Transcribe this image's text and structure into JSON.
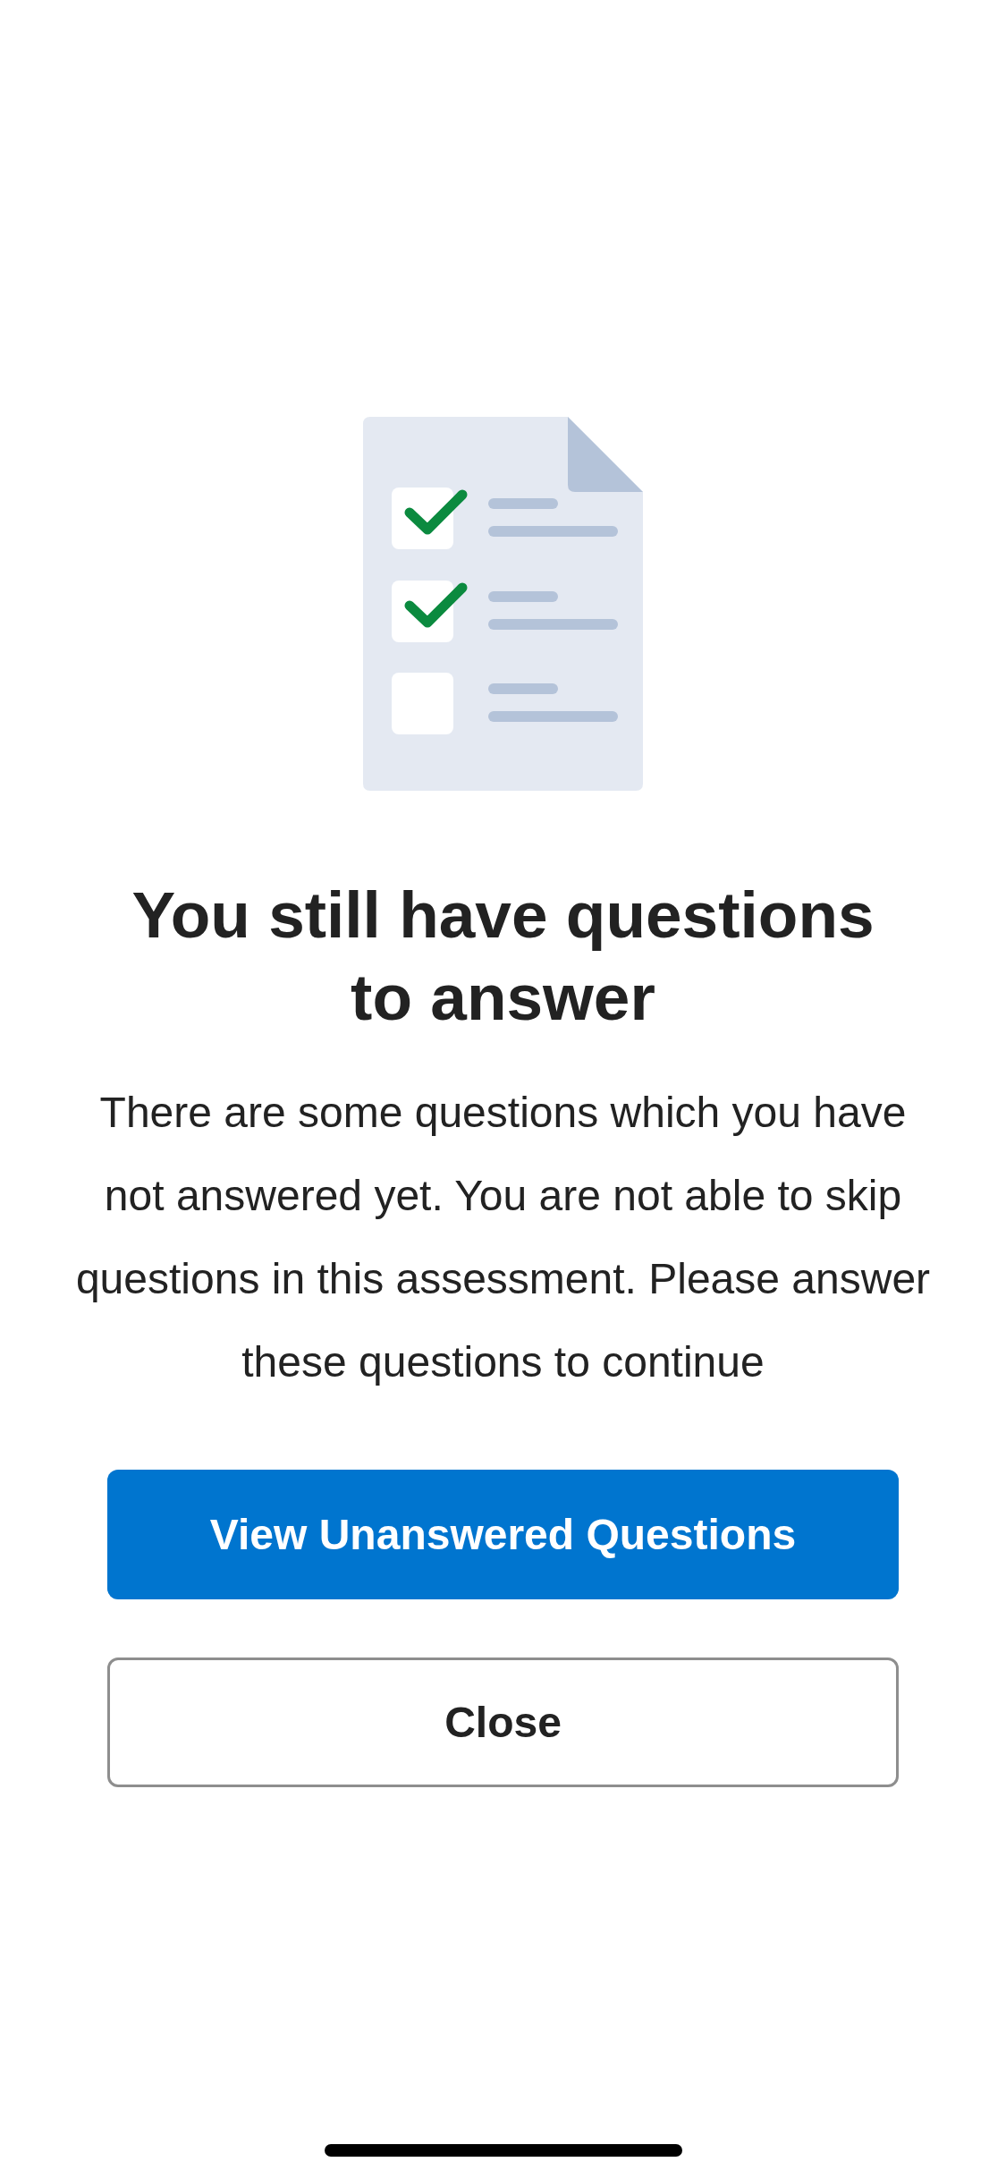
{
  "illustration": {
    "checkboxes": [
      {
        "checked": true
      },
      {
        "checked": true
      },
      {
        "checked": false
      }
    ]
  },
  "title": "You still have questions to answer",
  "message": "There are some questions which you have not answered yet. You are not able to skip questions in this assessment. Please answer these questions to continue",
  "buttons": [
    {
      "kind": "primary",
      "label": "View Unanswered Questions"
    },
    {
      "kind": "secondary",
      "label": "Close"
    }
  ]
}
